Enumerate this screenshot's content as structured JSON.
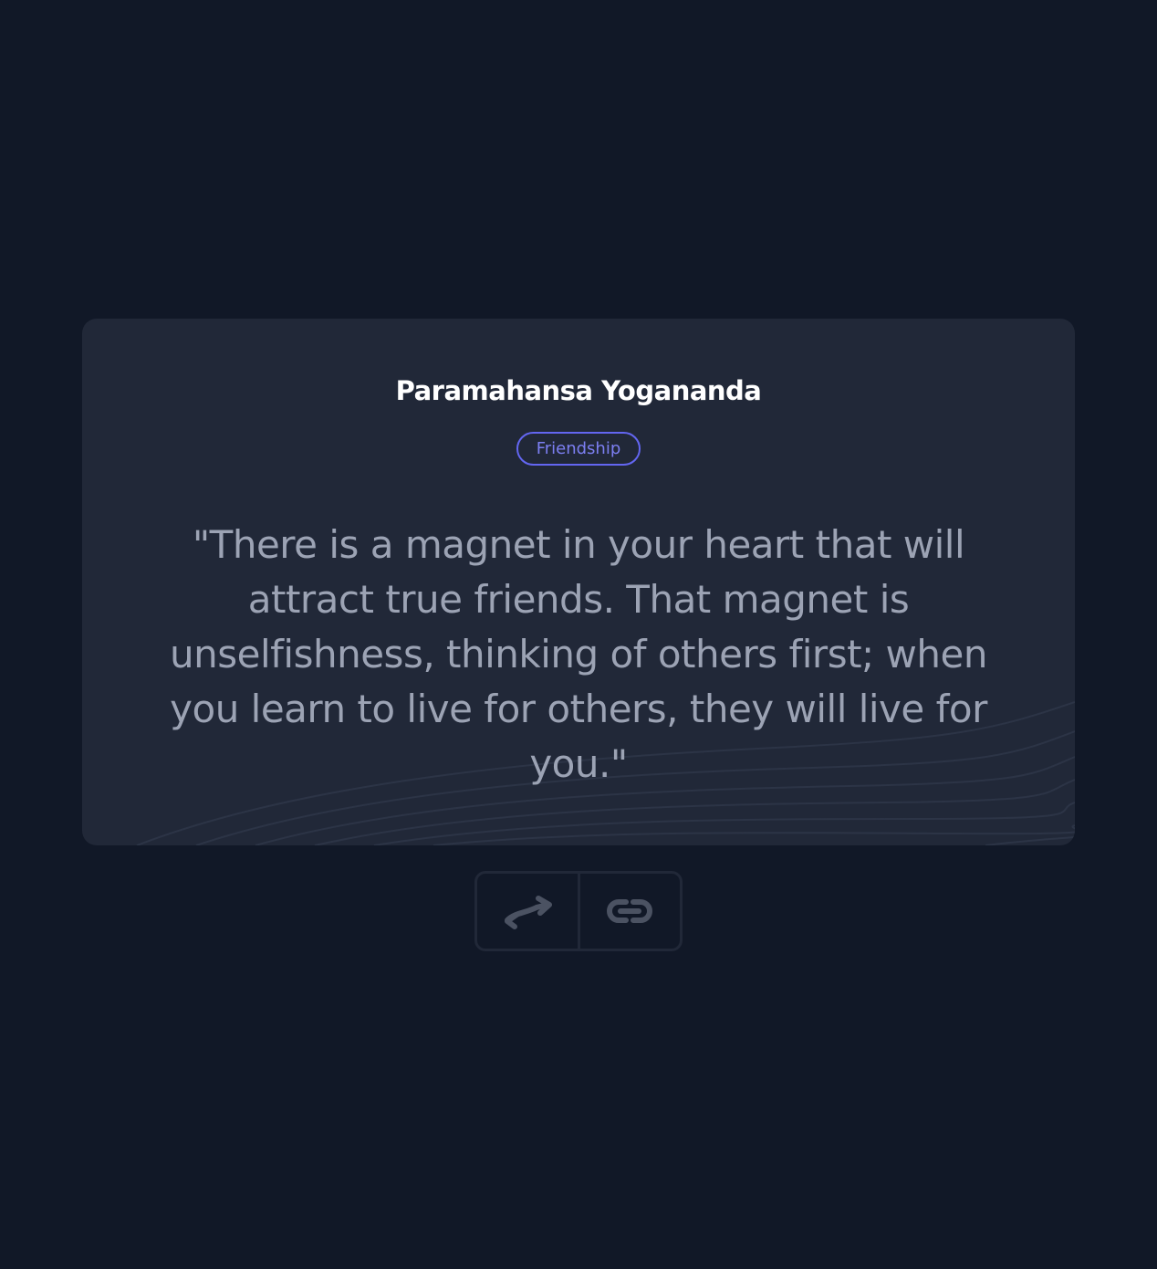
{
  "quote_card": {
    "author": "Paramahansa Yogananda",
    "tag": "Friendship",
    "quote": "\"There is a magnet in your heart that will attract true friends. That magnet is unselfishness, thinking of others first; when you learn to live for others, they will live for you.\""
  },
  "actions": {
    "new_quote_icon": "swap-arrows-icon",
    "copy_link_icon": "link-icon"
  },
  "colors": {
    "background": "#111827",
    "card": "#212838",
    "accent": "#6366f1",
    "quote_text": "#9ca3b4"
  }
}
